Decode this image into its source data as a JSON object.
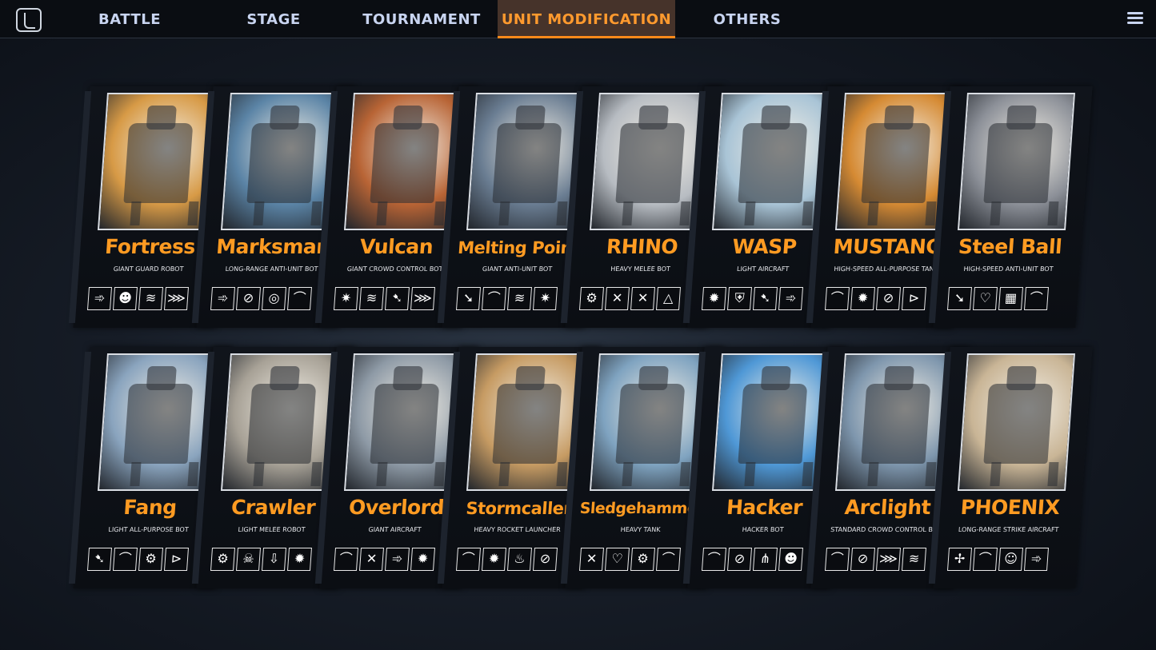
{
  "nav": {
    "tabs": [
      {
        "label": "BATTLE",
        "active": false
      },
      {
        "label": "STAGE",
        "active": false
      },
      {
        "label": "TOURNAMENT",
        "active": false
      },
      {
        "label": "UNIT MODIFICATION",
        "active": true
      },
      {
        "label": "OTHERS",
        "active": false
      }
    ],
    "logo_icon": "game-logo-icon",
    "menu_icon": "hamburger-menu-icon"
  },
  "colors": {
    "accent": "#ff9b22",
    "active_tab_bg": "#46332a",
    "tab_text": "#c8d4f0",
    "card_bg": "#0b0e13"
  },
  "units": [
    {
      "name": "Fortress",
      "subtitle": "GIANT GUARD ROBOT",
      "art_color": "#d79a46",
      "icons": [
        "➾",
        "☻",
        "≋",
        "⋙"
      ]
    },
    {
      "name": "Marksman",
      "subtitle": "LONG-RANGE ANTI-UNIT BOT",
      "art_color": "#5b84a6",
      "icons": [
        "➾",
        "⊘",
        "◎",
        "⌒"
      ]
    },
    {
      "name": "Vulcan",
      "subtitle": "GIANT CROWD CONTROL BOT",
      "art_color": "#b86435",
      "icons": [
        "✷",
        "≋",
        "➷",
        "⋙"
      ]
    },
    {
      "name": "Melting Point",
      "subtitle": "GIANT ANTI-UNIT BOT",
      "art_color": "#6a7d92",
      "icons": [
        "➘",
        "⌒",
        "≋",
        "✷"
      ]
    },
    {
      "name": "RHINO",
      "subtitle": "HEAVY MELEE BOT",
      "art_color": "#b7bcc2",
      "icons": [
        "⚙",
        "✕",
        "✕",
        "△"
      ]
    },
    {
      "name": "WASP",
      "subtitle": "LIGHT AIRCRAFT",
      "art_color": "#a9c4d6",
      "icons": [
        "✹",
        "⛨",
        "➷",
        "➾"
      ]
    },
    {
      "name": "MUSTANG",
      "subtitle": "HIGH-SPEED ALL-PURPOSE TANK",
      "art_color": "#d58a33",
      "icons": [
        "⌒",
        "✹",
        "⊘",
        "⊳"
      ]
    },
    {
      "name": "Steel Ball",
      "subtitle": "HIGH-SPEED ANTI-UNIT BOT",
      "art_color": "#8c9098",
      "icons": [
        "➘",
        "♡",
        "▦",
        "⌒"
      ]
    },
    {
      "name": "Fang",
      "subtitle": "LIGHT ALL-PURPOSE BOT",
      "art_color": "#8aa4be",
      "icons": [
        "➷",
        "⌒",
        "⚙",
        "⊳"
      ]
    },
    {
      "name": "Crawler",
      "subtitle": "LIGHT MELEE ROBOT",
      "art_color": "#a7a196",
      "icons": [
        "⚙",
        "☠",
        "⇩",
        "✹"
      ]
    },
    {
      "name": "Overlord",
      "subtitle": "GIANT AIRCRAFT",
      "art_color": "#8e9aa6",
      "icons": [
        "⌒",
        "✕",
        "➾",
        "✹"
      ]
    },
    {
      "name": "Stormcaller",
      "subtitle": "HEAVY ROCKET LAUNCHER",
      "art_color": "#c69b63",
      "icons": [
        "⌒",
        "✹",
        "♨",
        "⊘"
      ]
    },
    {
      "name": "Sledgehammer",
      "subtitle": "HEAVY TANK",
      "art_color": "#7fa3c0",
      "icons": [
        "✕",
        "♡",
        "⚙",
        "⌒"
      ]
    },
    {
      "name": "Hacker",
      "subtitle": "HACKER BOT",
      "art_color": "#4f98d6",
      "icons": [
        "⌒",
        "⊘",
        "⋔",
        "☻"
      ]
    },
    {
      "name": "Arclight",
      "subtitle": "STANDARD CROWD CONTROL BOT",
      "art_color": "#7e96ad",
      "icons": [
        "⌒",
        "⊘",
        "⋙",
        "≋"
      ]
    },
    {
      "name": "PHOENIX",
      "subtitle": "LONG-RANGE STRIKE AIRCRAFT",
      "art_color": "#c9b596",
      "icons": [
        "✢",
        "⌒",
        "☺",
        "➾"
      ]
    }
  ]
}
